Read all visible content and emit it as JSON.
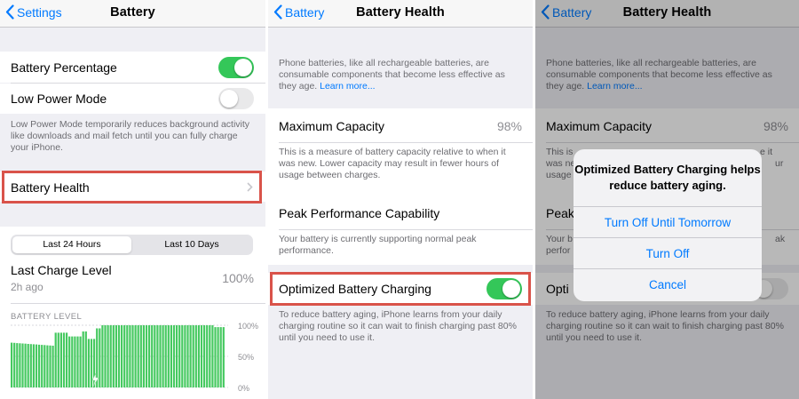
{
  "colors": {
    "ios_blue": "#007aff",
    "switch_on": "#34c759",
    "switch_off": "#e9e9ea",
    "highlight_box": "#d9534a",
    "chart_bar": "#46c960",
    "background": "#efeff4"
  },
  "screen1": {
    "nav": {
      "back_label": "Settings",
      "title": "Battery",
      "back_icon": "chevron-left-icon"
    },
    "battery_percentage": {
      "label": "Battery Percentage",
      "switch_on": true
    },
    "low_power_mode": {
      "label": "Low Power Mode",
      "switch_on": false
    },
    "low_power_footer": "Low Power Mode temporarily reduces background activity like downloads and mail fetch until you can fully charge your iPhone.",
    "battery_health": {
      "label": "Battery Health",
      "disclosure_icon": "chevron-right-icon"
    },
    "segment": {
      "options": [
        "Last 24 Hours",
        "Last 10 Days"
      ],
      "selected": "Last 24 Hours"
    },
    "last_charge": {
      "label": "Last Charge Level",
      "time": "2h ago",
      "value": "100%"
    },
    "chart": {
      "title": "BATTERY LEVEL",
      "y_ticks": [
        "100%",
        "50%",
        "0%"
      ],
      "charging_icon": "lightning-bolt-icon"
    }
  },
  "screen2": {
    "nav": {
      "back_label": "Battery",
      "title": "Battery Health",
      "back_icon": "chevron-left-icon"
    },
    "intro": "Phone batteries, like all rechargeable batteries, are consumable components that become less effective as they age.",
    "learn_more": "Learn more...",
    "max_capacity": {
      "label": "Maximum Capacity",
      "value": "98%"
    },
    "max_capacity_footer": "This is a measure of battery capacity relative to when it was new. Lower capacity may result in fewer hours of usage between charges.",
    "peak_performance": {
      "label": "Peak Performance Capability",
      "footer": "Your battery is currently supporting normal peak performance."
    },
    "optimized_charging": {
      "label": "Optimized Battery Charging",
      "switch_on": true
    },
    "optimized_footer": "To reduce battery aging, iPhone learns from your daily charging routine so it can wait to finish charging past 80% until you need to use it."
  },
  "screen3": {
    "nav": {
      "back_label": "Battery",
      "title": "Battery Health",
      "back_icon": "chevron-left-icon"
    },
    "intro": "Phone batteries, like all rechargeable batteries, are consumable components that become less effective as they age.",
    "learn_more": "Learn more...",
    "max_capacity": {
      "label": "Maximum Capacity",
      "value": "98%"
    },
    "max_capacity_footer_visible": [
      "This is",
      "e it",
      "was ne",
      "ur",
      "usage b"
    ],
    "peak_partial": "Peak",
    "peak_footer_visible": [
      "Your b",
      "ak",
      "perfor"
    ],
    "optimized_partial": "Opti",
    "optimized_footer": "To reduce battery aging, iPhone learns from your daily charging routine so it can wait to finish charging past 80% until you need to use it.",
    "alert": {
      "title": "Optimized Battery Charging helps reduce battery aging.",
      "buttons": [
        "Turn Off Until Tomorrow",
        "Turn Off",
        "Cancel"
      ]
    }
  }
}
